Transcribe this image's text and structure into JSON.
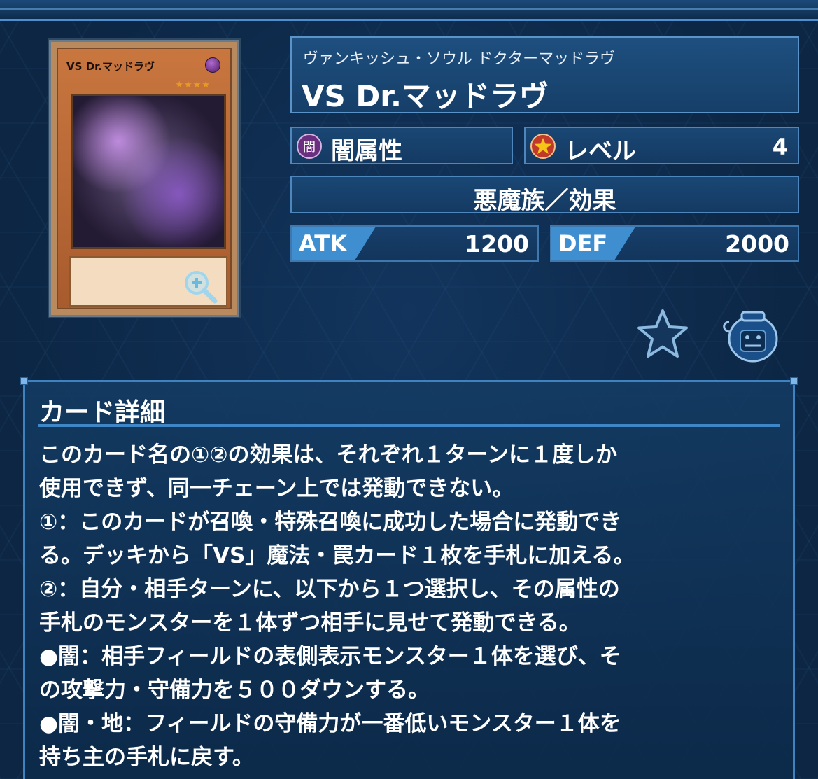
{
  "card_art": {
    "name": "VS Dr.マッドラヴ",
    "stars": "★★★★"
  },
  "header": {
    "ruby": "ヴァンキッシュ・ソウル ドクターマッドラヴ",
    "title": "VS Dr.マッドラヴ"
  },
  "attribute": {
    "icon_char": "闇",
    "label": "闇属性"
  },
  "level": {
    "label": "レベル",
    "value": "4"
  },
  "type_line": "悪魔族／効果",
  "atk": {
    "label": "ATK",
    "value": "1200"
  },
  "def": {
    "label": "DEF",
    "value": "2000"
  },
  "icons": {
    "favorite": "star-icon",
    "jar": "pot-of-greed-icon",
    "zoom": "zoom-in-icon"
  },
  "detail": {
    "title": "カード詳細",
    "lines": [
      "このカード名の①②の効果は、それぞれ１ターンに１度しか",
      "使用できず、同一チェーン上では発動できない。",
      "①：このカードが召喚・特殊召喚に成功した場合に発動でき",
      "る。デッキから「VS」魔法・罠カード１枚を手札に加える。",
      "②：自分・相手ターンに、以下から１つ選択し、その属性の",
      "手札のモンスターを１体ずつ相手に見せて発動できる。",
      "●闇：相手フィールドの表側表示モンスター１体を選び、そ",
      "の攻撃力・守備力を５００ダウンする。",
      "●闇・地：フィールドの守備力が一番低いモンスター１体を",
      "持ち主の手札に戻す。"
    ]
  },
  "colors": {
    "background": "#0c2644",
    "panel": "#1a4775",
    "accent": "#3f8fd0",
    "card_frame": "#c9763f"
  }
}
